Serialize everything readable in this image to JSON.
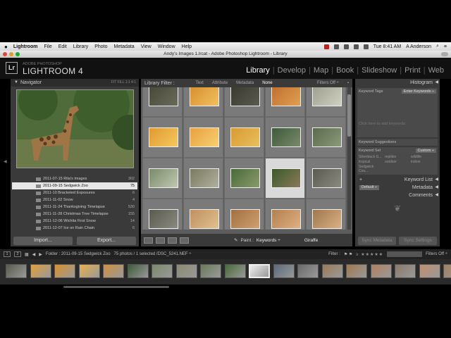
{
  "menubar": {
    "app_name": "Lightroom",
    "items": [
      "File",
      "Edit",
      "Library",
      "Photo",
      "Metadata",
      "View",
      "Window",
      "Help"
    ],
    "time": "Tue 8:41 AM",
    "user": "A Anderson"
  },
  "window": {
    "title": "Andy's Images 1.lrcat - Adobe Photoshop Lightroom - Library"
  },
  "identity": {
    "badge": "Lr",
    "small": "ADOBE PHOTOSHOP",
    "big": "LIGHTROOM 4",
    "modules": [
      "Library",
      "Develop",
      "Map",
      "Book",
      "Slideshow",
      "Print",
      "Web"
    ],
    "active_module": "Library"
  },
  "navigator": {
    "title": "Navigator",
    "zoom": "FIT  FILL  1:1  4:1"
  },
  "folders": [
    {
      "name": "2011-07-15 Rita's Images",
      "count": "302"
    },
    {
      "name": "2011-09-15 Sedgwick Zoo",
      "count": "75",
      "selected": true
    },
    {
      "name": "2011-10 Bracketed Exposures",
      "count": "6"
    },
    {
      "name": "2011-11-02 Snow",
      "count": "4"
    },
    {
      "name": "2011-11-24 Thanksgiving Timelapse",
      "count": "530"
    },
    {
      "name": "2011-11-28 Christmas Tree Timelapse",
      "count": "155"
    },
    {
      "name": "2011-12-06 Wichita First Snow",
      "count": "14"
    },
    {
      "name": "2011-12-07 Ice on Rain Chain",
      "count": "6"
    }
  ],
  "left_buttons": {
    "import": "Import...",
    "export": "Export..."
  },
  "filterbar": {
    "label": "Library Filter :",
    "text": "Text",
    "attribute": "Attribute",
    "metadata": "Metadata",
    "none": "None",
    "filters_off": "Filters Off ÷"
  },
  "toolbar": {
    "paint": "Paint :",
    "keywords": "Keywords ÷",
    "giraffe": "Giraffe"
  },
  "right_panel": {
    "histogram": "Histogram",
    "keyword_tags": "Keyword Tags",
    "enter_keywords": "Enter Keywords ÷",
    "click_hint": "Click here to add keywords",
    "keyword_suggestions": "Keyword Suggestions",
    "keyword_set": "Keyword Set",
    "custom": "Custom ÷",
    "set_words": [
      "Silverback G...",
      "reptiles",
      "wildlife",
      "tropical",
      "outdoor",
      "indoor",
      "Sedgwick Cou...",
      "",
      ""
    ],
    "keyword_list": "Keyword List",
    "metadata": "Metadata",
    "default": "Default ÷",
    "comments": "Comments",
    "sync_metadata": "Sync Metadata",
    "sync_settings": "Sync Settings"
  },
  "filmstrip_bar": {
    "n1": "1",
    "n2": "2",
    "folder": "Folder : 2011-09-15 Sedgwick Zoo",
    "photos": "75 photos / 1 selected /DSC_5241.NEF ÷",
    "filter": "Filter :",
    "stars": "≥ ★★★★★",
    "filters_off": "Filters Off ÷"
  }
}
